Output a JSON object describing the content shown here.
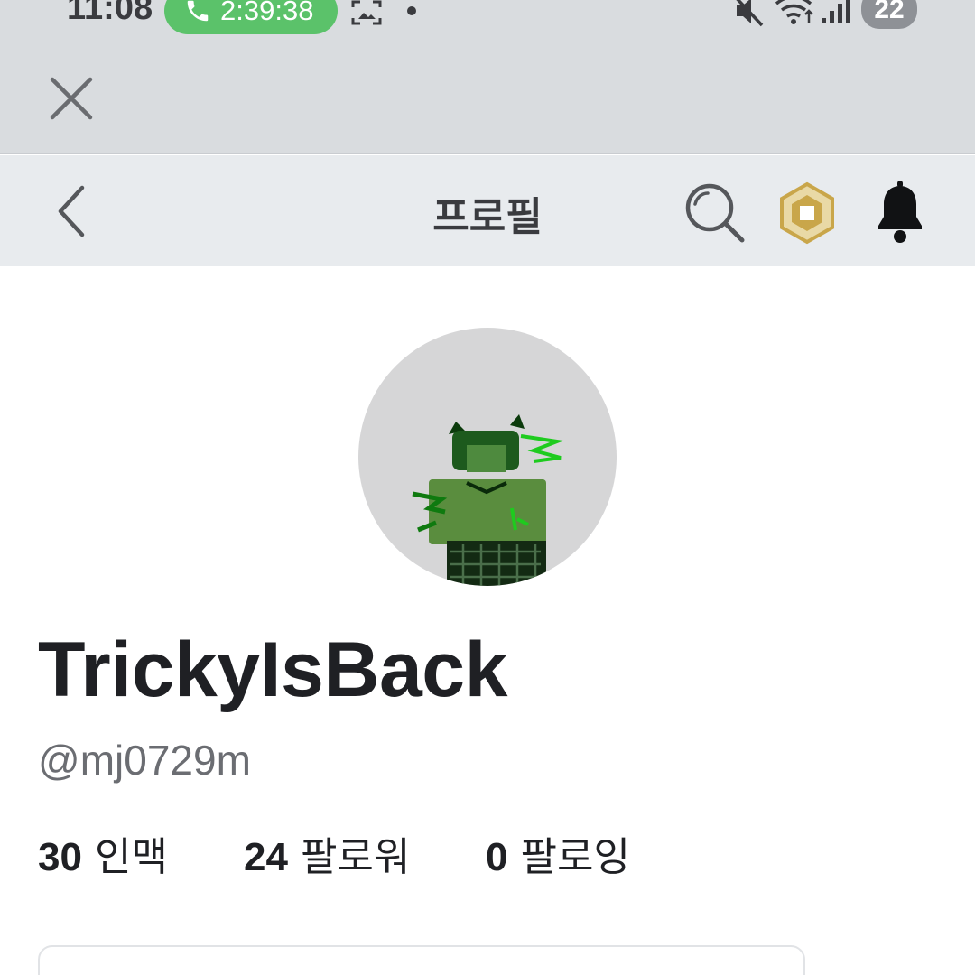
{
  "status_bar": {
    "time": "11:08",
    "call_timer": "2:39:38",
    "battery": "22",
    "icons": [
      "phone-icon",
      "screenshot-icon",
      "mute-icon",
      "wifi-icon",
      "signal-icon"
    ]
  },
  "webview": {
    "close_icon": "close-icon"
  },
  "nav": {
    "title": "프로필",
    "icons": [
      "back-icon",
      "search-icon",
      "robux-icon",
      "bell-icon"
    ]
  },
  "profile": {
    "display_name": "TrickyIsBack",
    "username": "@mj0729m",
    "stats": [
      {
        "count": "30",
        "label": "인맥"
      },
      {
        "count": "24",
        "label": "팔로워"
      },
      {
        "count": "0",
        "label": "팔로잉"
      }
    ]
  },
  "colors": {
    "status_bar_bg": "#d9dcdf",
    "nav_bar_bg": "#e8ebee",
    "call_pill": "#5bc26a",
    "robux_gold": "#c9a64a",
    "text_primary": "#1f2024",
    "text_secondary": "#6b6d72"
  }
}
